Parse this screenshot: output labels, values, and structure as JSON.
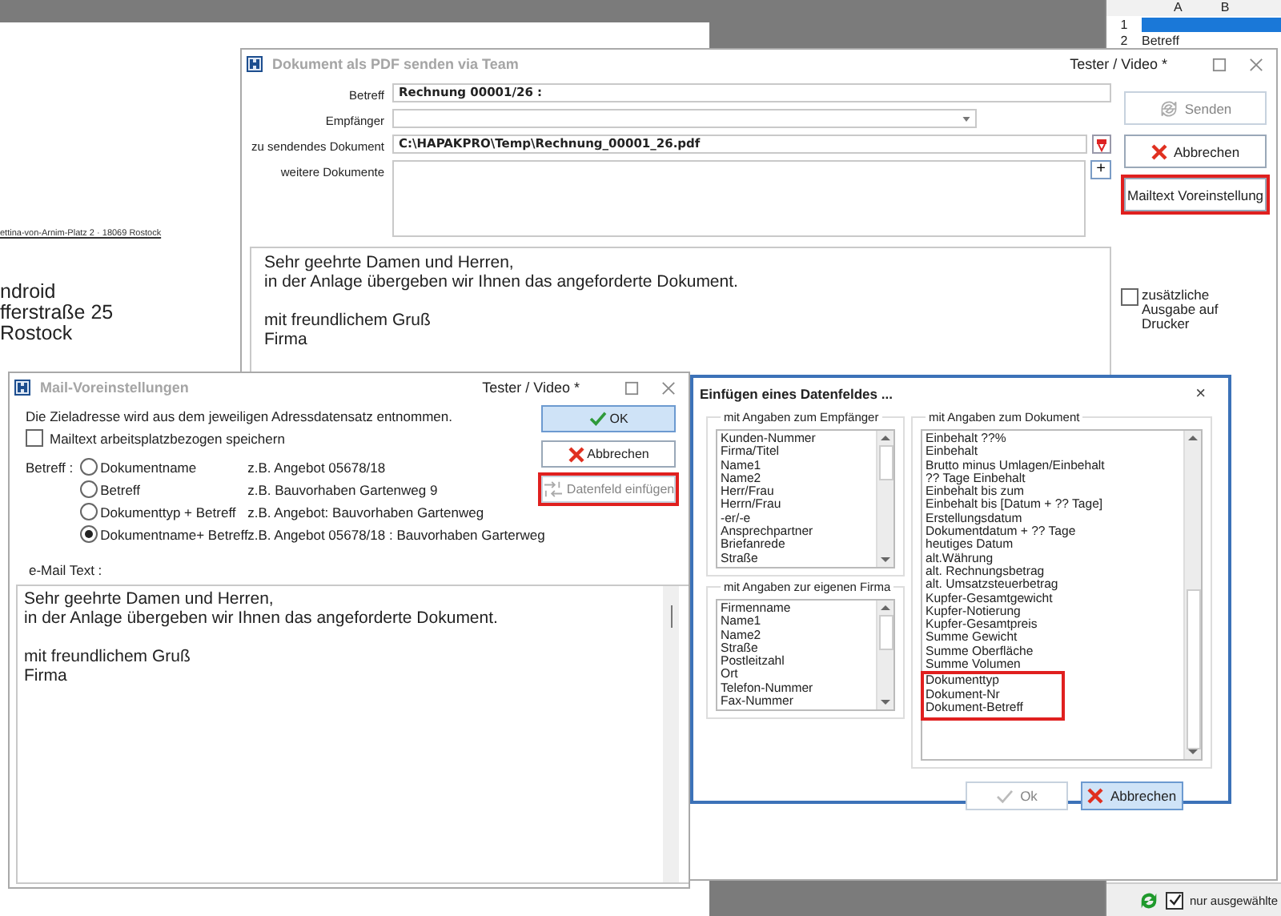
{
  "background_document": {
    "sender_line": "ettina-von-Arnim-Platz 2 · 18069 Rostock",
    "address_lines": [
      "ndroid",
      "fferstraße 25",
      "Rostock"
    ]
  },
  "spreadsheet": {
    "columns": [
      "A",
      "B"
    ],
    "rows": [
      {
        "number": "1",
        "selected": true
      },
      {
        "number": "2",
        "text": "Betreff",
        "selected": false
      }
    ],
    "only_selected": {
      "label": "nur ausgewählte",
      "checked": true
    }
  },
  "pdf_window": {
    "title": "Dokument als PDF senden via Team",
    "user": "Tester / Video *",
    "fields": [
      {
        "kind": "text",
        "label": "Betreff",
        "value": "Rechnung 00001/26 :"
      },
      {
        "kind": "dropdown",
        "label": "Empfänger"
      },
      {
        "kind": "file",
        "label": "zu sendendes Dokument",
        "value": "C:\\HAPAKPRO\\Temp\\Rechnung_00001_26.pdf"
      },
      {
        "kind": "list",
        "label": "weitere Dokumente",
        "button": "+"
      }
    ],
    "buttons": [
      {
        "kind": "send",
        "label": "Senden",
        "disabled": true,
        "highlighted": false
      },
      {
        "kind": "cancel",
        "label": "Abbrechen",
        "disabled": false,
        "highlighted": false
      },
      {
        "kind": "plain",
        "label": "Mailtext Voreinstellung",
        "disabled": false,
        "highlighted": true
      }
    ],
    "message_paragraphs": [
      [
        "Sehr geehrte Damen und Herren,",
        "in der Anlage übergeben wir Ihnen das angeforderte Dokument."
      ],
      [
        "mit freundlichem Gruß",
        "Firma"
      ]
    ],
    "print_option": {
      "label": "zusätzliche Ausgabe auf Drucker",
      "checked": false
    }
  },
  "mail_window": {
    "title": "Mail-Voreinstellungen",
    "user": "Tester / Video *",
    "info": "Die Zieladresse wird aus dem jeweiligen Adressdatensatz entnommen.",
    "save_option": {
      "label": "Mailtext arbeitsplatzbezogen speichern",
      "checked": false
    },
    "subject_label": "Betreff :",
    "subject_options": [
      {
        "label": "Dokumentname",
        "example": "z.B. Angebot 05678/18",
        "selected": false
      },
      {
        "label": "Betreff",
        "example": "z.B. Bauvorhaben Gartenweg 9",
        "selected": false
      },
      {
        "label": "Dokumenttyp + Betreff",
        "example": "z.B. Angebot: Bauvorhaben Gartenweg",
        "selected": false
      },
      {
        "label": "Dokumentname+ Betreff",
        "example": "z.B. Angebot 05678/18 : Bauvorhaben Garterweg",
        "selected": true
      }
    ],
    "buttons": [
      {
        "kind": "ok",
        "label": "OK",
        "disabled": false,
        "highlighted": false,
        "focused": true
      },
      {
        "kind": "cancel",
        "label": "Abbrechen",
        "disabled": false,
        "highlighted": false,
        "focused": false
      },
      {
        "kind": "insert",
        "label": "Datenfeld einfügen",
        "disabled": true,
        "highlighted": true,
        "focused": false
      }
    ],
    "mail_text_label": "e-Mail Text :",
    "mail_text_paragraphs": [
      [
        "Sehr geehrte Damen und Herren,",
        "in der Anlage übergeben wir Ihnen das angeforderte Dokument."
      ],
      [
        "mit freundlichem Gruß",
        "Firma"
      ]
    ]
  },
  "insert_dialog": {
    "title": "Einfügen eines Datenfeldes ...",
    "close": "×",
    "recipient_group": {
      "title": "mit Angaben zum Empfänger",
      "items": [
        "Kunden-Nummer",
        "Firma/Titel",
        "Name1",
        "Name2",
        "Herr/Frau",
        "Herrn/Frau",
        "-er/-e",
        "Ansprechpartner",
        "Briefanrede",
        "Straße"
      ]
    },
    "company_group": {
      "title": "mit Angaben zur eigenen Firma",
      "items": [
        "Firmenname",
        "Name1",
        "Name2",
        "Straße",
        "Postleitzahl",
        "Ort",
        "Telefon-Nummer",
        "Fax-Nummer"
      ]
    },
    "document_group": {
      "title": "mit Angaben zum Dokument",
      "items": [
        {
          "label": "Einbehalt ??%",
          "highlighted": false
        },
        {
          "label": "Einbehalt",
          "highlighted": false
        },
        {
          "label": "Brutto minus Umlagen/Einbehalt",
          "highlighted": false
        },
        {
          "label": "?? Tage Einbehalt",
          "highlighted": false
        },
        {
          "label": "Einbehalt bis zum",
          "highlighted": false
        },
        {
          "label": "Einbehalt bis [Datum + ?? Tage]",
          "highlighted": false
        },
        {
          "label": "Erstellungsdatum",
          "highlighted": false
        },
        {
          "label": "Dokumentdatum + ?? Tage",
          "highlighted": false
        },
        {
          "label": "heutiges Datum",
          "highlighted": false
        },
        {
          "label": "alt.Währung",
          "highlighted": false
        },
        {
          "label": "alt. Rechnungsbetrag",
          "highlighted": false
        },
        {
          "label": "alt. Umsatzsteuerbetrag",
          "highlighted": false
        },
        {
          "label": "Kupfer-Gesamtgewicht",
          "highlighted": false
        },
        {
          "label": "Kupfer-Notierung",
          "highlighted": false
        },
        {
          "label": "Kupfer-Gesamtpreis",
          "highlighted": false
        },
        {
          "label": "Summe Gewicht",
          "highlighted": false
        },
        {
          "label": "Summe Oberfläche",
          "highlighted": false
        },
        {
          "label": "Summe Volumen",
          "highlighted": false
        },
        {
          "label": "Dokumenttyp",
          "highlighted": true
        },
        {
          "label": "Dokument-Nr",
          "highlighted": true
        },
        {
          "label": "Dokument-Betreff",
          "highlighted": true
        }
      ]
    },
    "buttons": [
      {
        "kind": "ok",
        "label": "Ok",
        "disabled": true,
        "highlighted": false,
        "focused": false
      },
      {
        "kind": "cancel",
        "label": "Abbrechen",
        "disabled": false,
        "highlighted": false,
        "focused": true
      }
    ]
  }
}
